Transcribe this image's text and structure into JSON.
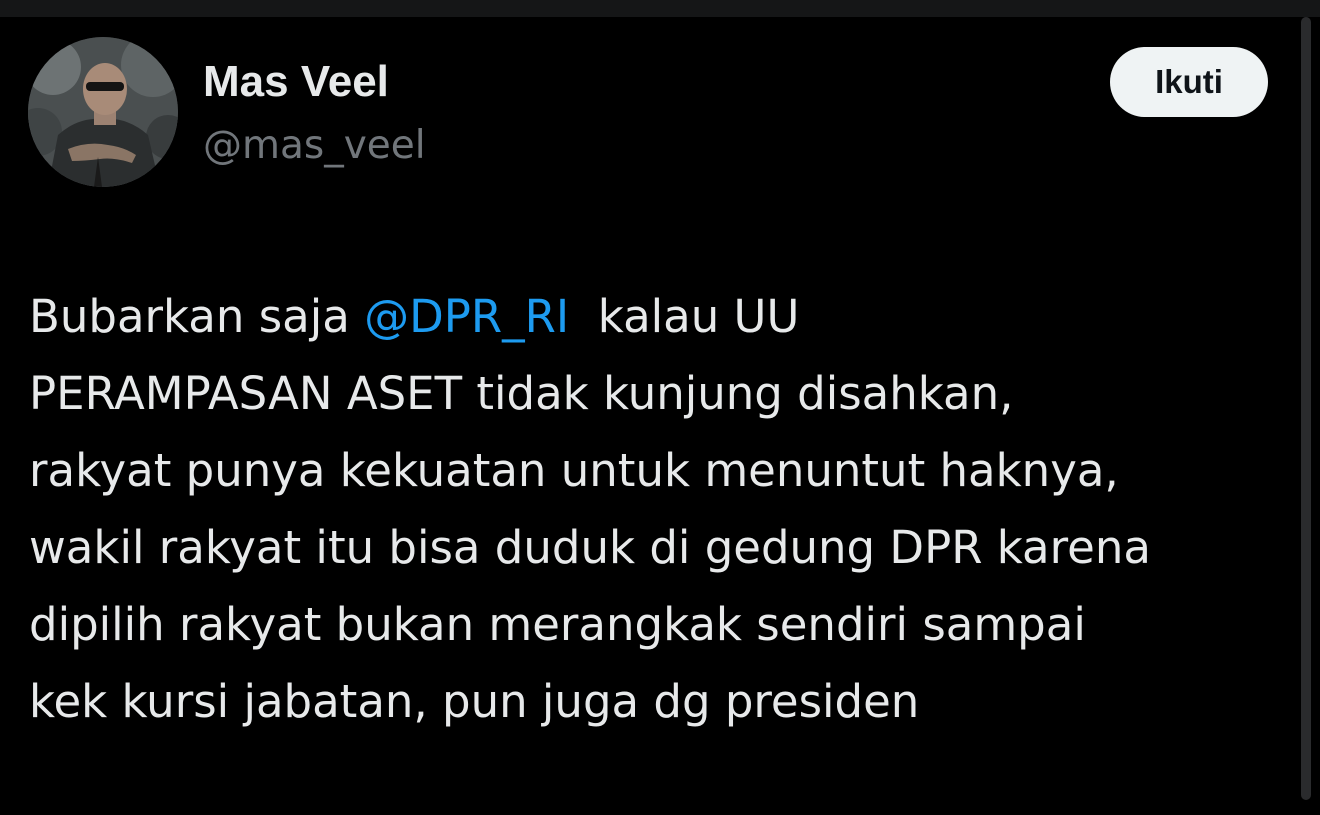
{
  "tweet": {
    "author": {
      "display_name": "Mas Veel",
      "handle": "@mas_veel"
    },
    "follow_label": "Ikuti",
    "lines": [
      {
        "before": "Bubarkan saja ",
        "mention": "@DPR_RI",
        "after": "  kalau UU"
      },
      {
        "text": "PERAMPASAN ASET tidak kunjung disahkan,"
      },
      {
        "text": "rakyat punya kekuatan untuk menuntut haknya,"
      },
      {
        "text": "wakil rakyat itu bisa duduk di gedung DPR karena"
      },
      {
        "text": "dipilih rakyat bukan merangkak sendiri sampai"
      },
      {
        "text": "kek kursi jabatan, pun juga dg presiden"
      }
    ]
  },
  "colors": {
    "background": "#000000",
    "text_primary": "#e7e9ea",
    "text_secondary": "#71767b",
    "mention": "#1d9bf0",
    "follow_button_bg": "#eff3f4",
    "follow_button_text": "#0f1419"
  }
}
